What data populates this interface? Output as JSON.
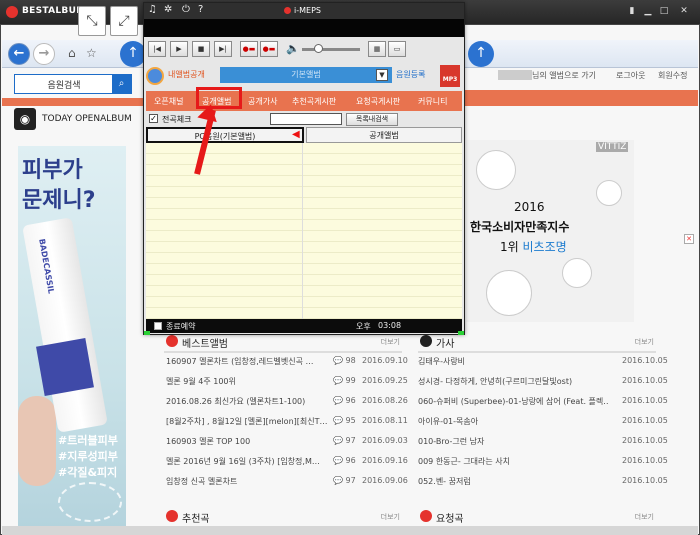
{
  "app": {
    "title": "BESTALBUM"
  },
  "left_page": {
    "search_label": "음원검색",
    "today_label": "TODAY OPENALBUM",
    "ad": {
      "line1": "피부가",
      "line2": "문제니?",
      "brand": "BADECASSIL",
      "tags": [
        "#트러블피부",
        "#지루성피부",
        "#각질&피지"
      ]
    }
  },
  "right_page": {
    "header": {
      "user_suffix": "님의 앨범으로 가기",
      "logout": "로그아웃",
      "edit": "회원수정"
    },
    "ad": {
      "brand": "VITTIZ",
      "year": "2016",
      "line1": "한국소비자만족지수",
      "line2_prefix": "1위 ",
      "line2_accent": "비츠조명"
    }
  },
  "player": {
    "title": "i-MEPS",
    "controls": [
      "|◀",
      "▶",
      "■",
      "▶|",
      "●▬",
      "●▬"
    ],
    "tab_my": "내앨범공개",
    "album_select": "기본앨범",
    "register": "음원등록",
    "mp3_logo": "MP3",
    "menu": [
      "오픈채널",
      "공개앨범",
      "공개가사",
      "추천곡게시판",
      "요청곡게시판",
      "커뮤니티"
    ],
    "check_all": "전곡체크",
    "search_list": "목록내검색",
    "col_pc": "PC음원(기본앨범)",
    "col_public": "공개앨범",
    "timer": "종료예약",
    "clock_ampm": "오후",
    "clock_time": "03:08"
  },
  "best": {
    "title": "베스트앨범",
    "more": "더보기",
    "rows": [
      {
        "t": "160907 멜론차트 (임창정,레드벨벳신곡 …",
        "c": "98",
        "d": "2016.09.10"
      },
      {
        "t": "멜론 9월 4주 100위",
        "c": "99",
        "d": "2016.09.25"
      },
      {
        "t": "2016.08.26 최신가요 (멜론차트1-100)",
        "c": "96",
        "d": "2016.08.26"
      },
      {
        "t": "[8월2주차] , 8월12일 [멜론][melon][최신T…",
        "c": "95",
        "d": "2016.08.11"
      },
      {
        "t": "160903 멜론 TOP 100",
        "c": "97",
        "d": "2016.09.03"
      },
      {
        "t": "멜론 2016년 9월 16일 (3주차) [임창정,M…",
        "c": "96",
        "d": "2016.09.16"
      },
      {
        "t": "임창정 신곡 멜론차트",
        "c": "97",
        "d": "2016.09.06"
      }
    ]
  },
  "lyrics": {
    "title": "가사",
    "more": "더보기",
    "rows": [
      {
        "t": "김태우-사랑비",
        "d": "2016.10.05"
      },
      {
        "t": "성시경- 다정하게, 안녕히(구르미그린달빛ost)",
        "d": "2016.10.05"
      },
      {
        "t": "060-슈퍼비 (Superbee)-01-낭랑에 삼어 (Feat. 플렉…",
        "d": "2016.10.05"
      },
      {
        "t": "아이유-01-목솜아",
        "d": "2016.10.05"
      },
      {
        "t": "010-Bro-그런 남자",
        "d": "2016.10.05"
      },
      {
        "t": "009 한동근- 그대라는 사치",
        "d": "2016.10.05"
      },
      {
        "t": "052.벤- 꿈저럼",
        "d": "2016.10.05"
      }
    ]
  },
  "recommend": {
    "title": "추천곡",
    "more": "더보기"
  },
  "request": {
    "title": "요청곡",
    "more": "더보기"
  },
  "colors": {
    "accent_orange": "#e8734f",
    "brand_red": "#e5322d",
    "nav_blue": "#2b72d0",
    "highlight_red": "#e61919"
  }
}
